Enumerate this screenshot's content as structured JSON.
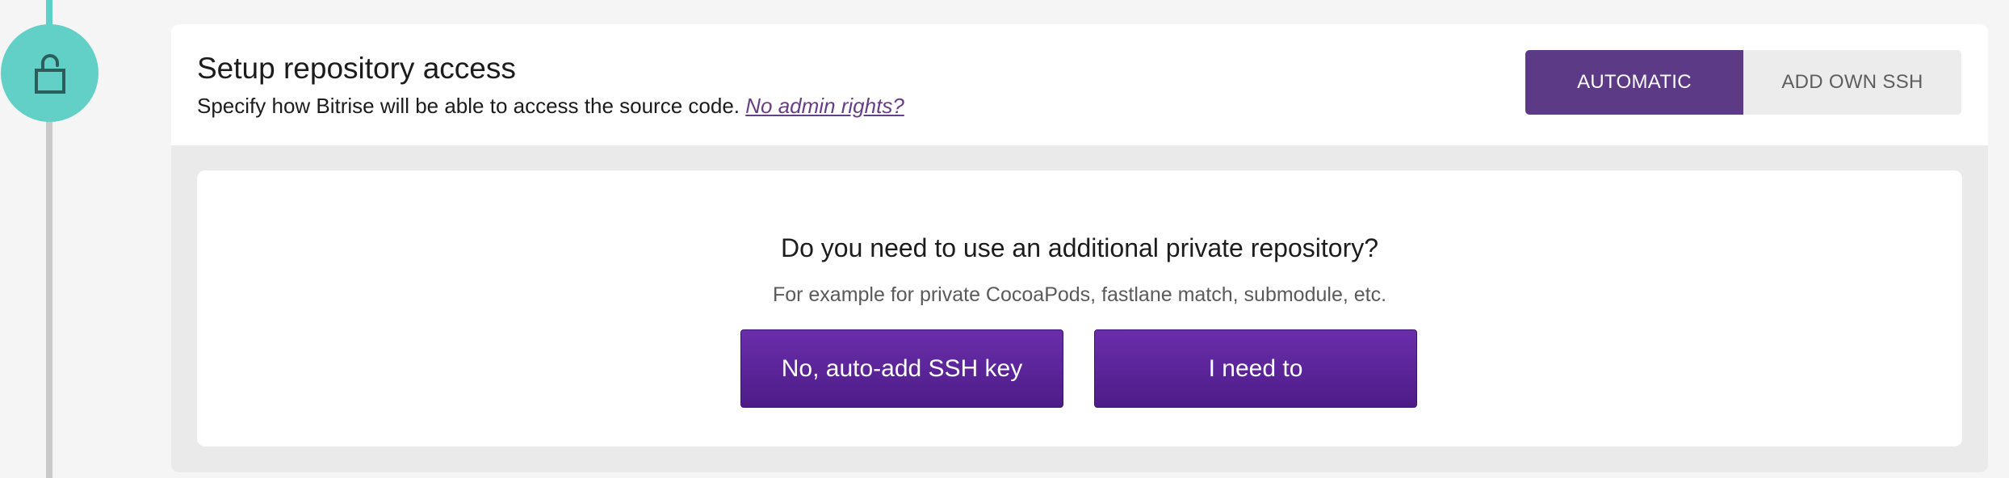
{
  "step": {
    "icon": "unlocked-padlock-icon",
    "accent_color": "#62d0c7"
  },
  "section": {
    "title": "Setup repository access",
    "description": "Specify how Bitrise will be able to access the source code.",
    "link_label": "No admin rights?"
  },
  "mode_toggle": {
    "options": [
      {
        "label": "AUTOMATIC",
        "selected": true
      },
      {
        "label": "ADD OWN SSH",
        "selected": false
      }
    ],
    "active_color": "#5c3a86"
  },
  "private_repo_prompt": {
    "question": "Do you need to use an additional private repository?",
    "hint": "For example for private CocoaPods, fastlane match, submodule, etc.",
    "buttons": {
      "no_label": "No, auto-add SSH key",
      "yes_label": "I need to"
    },
    "button_color": "#5b249a"
  }
}
